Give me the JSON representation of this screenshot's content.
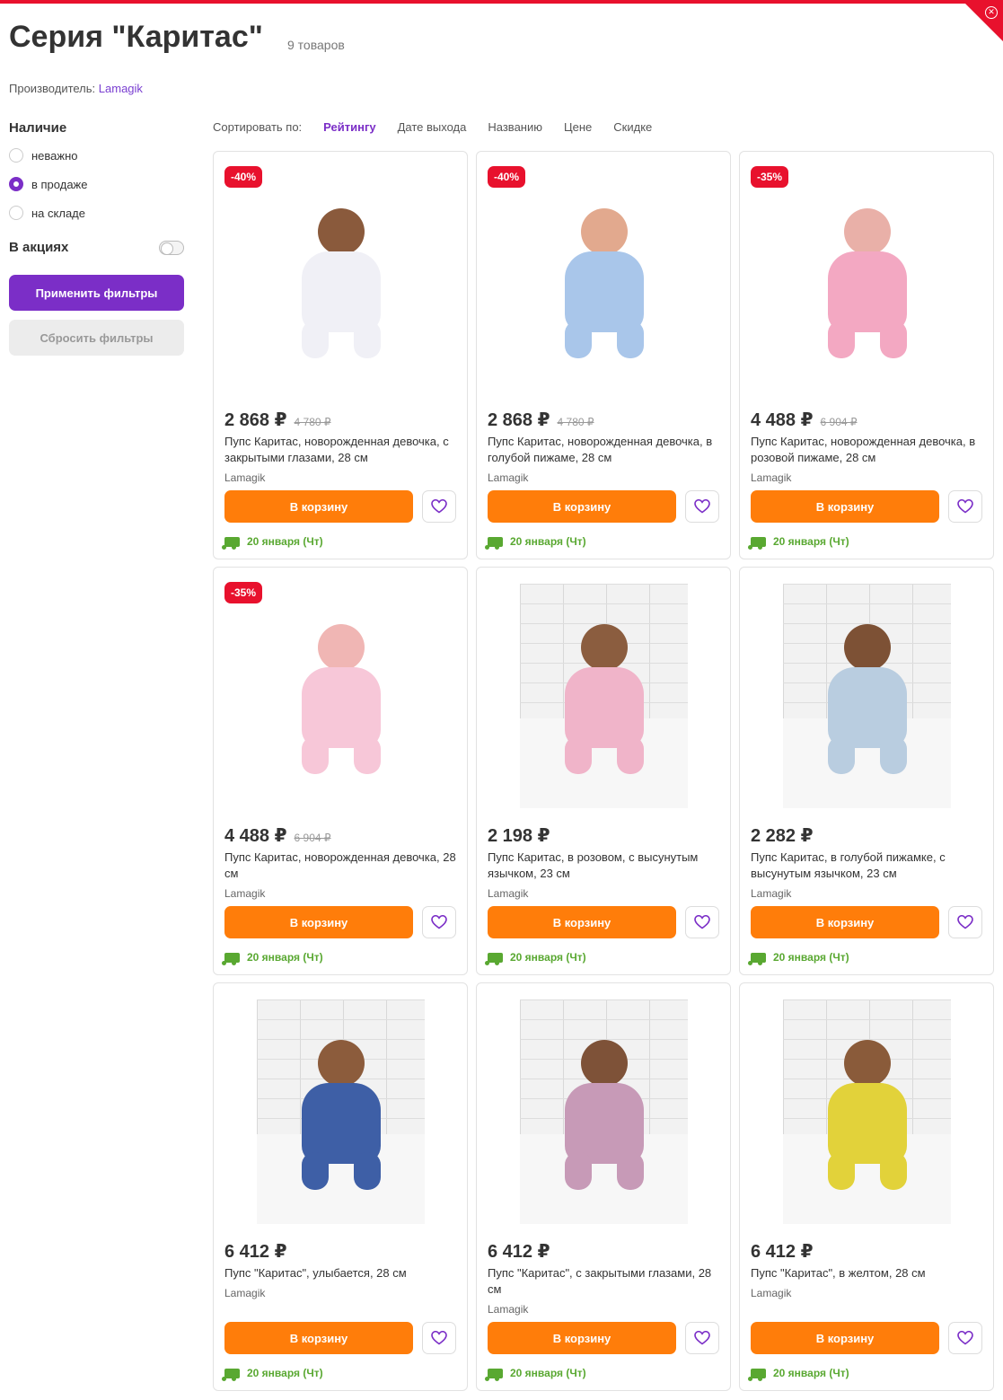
{
  "header": {
    "title": "Серия \"Каритас\"",
    "count": "9 товаров"
  },
  "maker": {
    "label": "Производитель:",
    "name": "Lamagik"
  },
  "filters": {
    "availability_title": "Наличие",
    "options": [
      {
        "label": "неважно",
        "selected": false
      },
      {
        "label": "в продаже",
        "selected": true
      },
      {
        "label": "на складе",
        "selected": false
      }
    ],
    "promo_label": "В акциях",
    "apply_label": "Применить фильтры",
    "reset_label": "Сбросить фильтры"
  },
  "sort": {
    "label": "Сортировать по:",
    "options": [
      "Рейтингу",
      "Дате выхода",
      "Названию",
      "Цене",
      "Скидке"
    ],
    "active": "Рейтингу"
  },
  "cart_label": "В корзину",
  "delivery_text": "20 января (Чт)",
  "colors": {
    "accent": "#7b2ec7",
    "cart": "#ff7d0a",
    "discount": "#e8112d",
    "delivery": "#59a831"
  },
  "products": [
    {
      "discount": "-40%",
      "price": "2 868 ₽",
      "old_price": "4 780 ₽",
      "name": "Пупс Каритас, новорожденная девочка, с закрытыми глазами, 28 см",
      "brand": "Lamagik"
    },
    {
      "discount": "-40%",
      "price": "2 868 ₽",
      "old_price": "4 780 ₽",
      "name": "Пупс Каритас, новорожденная девочка, в голубой пижаме, 28 см",
      "brand": "Lamagik"
    },
    {
      "discount": "-35%",
      "price": "4 488 ₽",
      "old_price": "6 904 ₽",
      "name": "Пупс Каритас, новорожденная девочка, в розовой пижаме, 28 см",
      "brand": "Lamagik"
    },
    {
      "discount": "-35%",
      "price": "4 488 ₽",
      "old_price": "6 904 ₽",
      "name": "Пупс Каритас, новорожденная девочка, 28 см",
      "brand": "Lamagik"
    },
    {
      "discount": "",
      "price": "2 198 ₽",
      "old_price": "",
      "name": "Пупс Каритас, в розовом, с высунутым язычком, 23 см",
      "brand": "Lamagik"
    },
    {
      "discount": "",
      "price": "2 282 ₽",
      "old_price": "",
      "name": "Пупс Каритас, в голубой пижамке, с высунутым язычком, 23 см",
      "brand": "Lamagik"
    },
    {
      "discount": "",
      "price": "6 412 ₽",
      "old_price": "",
      "name": "Пупс \"Каритас\", улыбается, 28 см",
      "brand": "Lamagik"
    },
    {
      "discount": "",
      "price": "6 412 ₽",
      "old_price": "",
      "name": "Пупс \"Каритас\", с закрытыми глазами, 28 см",
      "brand": "Lamagik"
    },
    {
      "discount": "",
      "price": "6 412 ₽",
      "old_price": "",
      "name": "Пупс \"Каритас\", в желтом, 28 см",
      "brand": "Lamagik"
    }
  ]
}
